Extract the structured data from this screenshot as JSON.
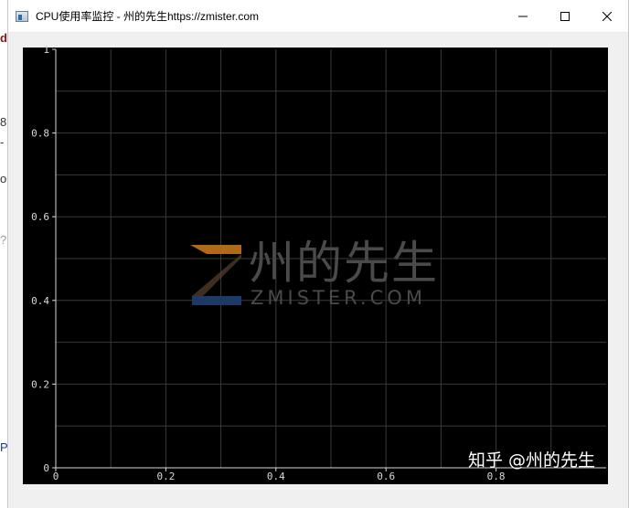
{
  "window": {
    "title": "CPU使用率监控 - 州的先生https://zmister.com",
    "icon": "app-window-icon",
    "buttons": {
      "minimize": "minimize-icon",
      "maximize": "maximize-icon",
      "close": "close-icon"
    }
  },
  "background": {
    "fragments": [
      "d",
      "8",
      "-",
      "o",
      "?",
      "P"
    ]
  },
  "chart_data": {
    "type": "line",
    "title": "",
    "xlabel": "",
    "ylabel": "",
    "xlim": [
      0,
      1
    ],
    "ylim": [
      0,
      1
    ],
    "x_ticks": [
      "0",
      "0.2",
      "0.4",
      "0.6",
      "0.8"
    ],
    "y_ticks": [
      "0",
      "0.2",
      "0.4",
      "0.6",
      "0.8",
      "1"
    ],
    "series": [],
    "grid": true,
    "background": "#000000",
    "grid_color": "#3a3a3a",
    "axis_color": "#d9d9d9"
  },
  "watermark": {
    "chinese": "州的先生",
    "english": "ZMISTER.COM",
    "z_color_top": "#b06a1a",
    "z_color_bottom": "#1d3a66"
  },
  "zhihu_watermark": "知乎 @州的先生"
}
